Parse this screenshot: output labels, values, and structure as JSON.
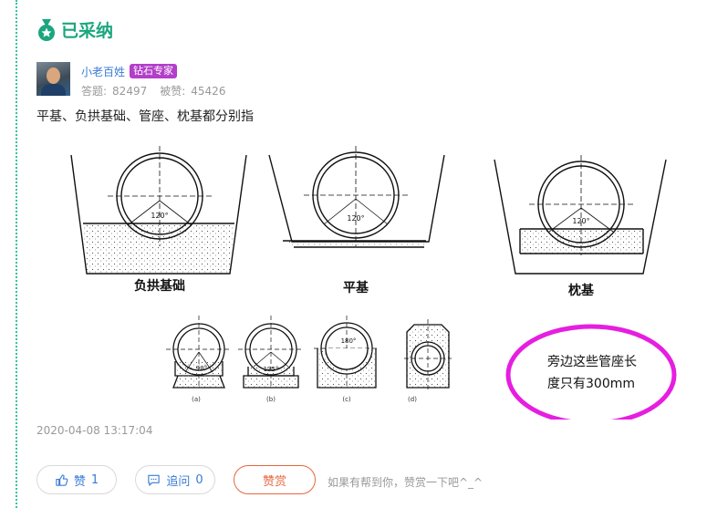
{
  "status": {
    "accepted_label": "已采纳"
  },
  "answerer": {
    "name": "小老百姓",
    "badge": "钻石专家",
    "answers_label": "答题:",
    "answers_count": "82497",
    "likes_label": "被赞:",
    "likes_count": "45426"
  },
  "answer": {
    "text": "平基、负拱基础、管座、枕基都分别指"
  },
  "figure": {
    "labels": {
      "negative_arch": "负拱基础",
      "flat": "平基",
      "pillow": "枕基",
      "angle_120": "120°",
      "angle_90": "90°",
      "angle_135": "135°",
      "angle_180": "180°",
      "sub_a": "(a)",
      "sub_b": "(b)",
      "sub_c": "(c)",
      "sub_d": "(d)"
    },
    "annotation_line1": "旁边这些管座长",
    "annotation_line2": "度只有300mm",
    "annotation_color": "#e61ee0"
  },
  "meta": {
    "timestamp": "2020-04-08 13:17:04"
  },
  "actions": {
    "like_label": "赞",
    "like_count": "1",
    "ask_label": "追问",
    "ask_count": "0",
    "reward_label": "赞赏",
    "hint": "如果有帮到你，赞赏一下吧^_^"
  },
  "colors": {
    "accent_green": "#1aa67e",
    "link_blue": "#3a7bd5",
    "badge_purple": "#b33ec9",
    "reward_orange": "#e8663d"
  }
}
